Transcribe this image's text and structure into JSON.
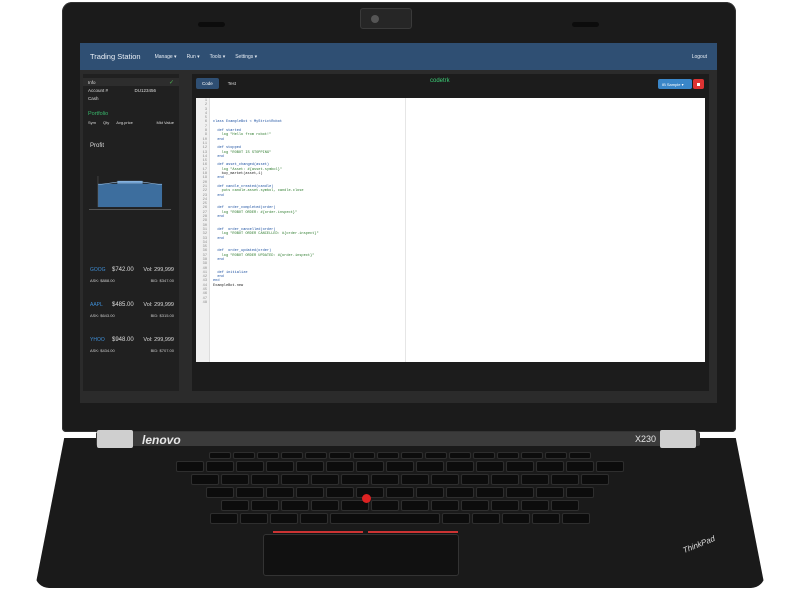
{
  "app": {
    "title": "Trading Station"
  },
  "nav": {
    "items": [
      "Manage ▾",
      "Run ▾",
      "Tools ▾",
      "Settings ▾"
    ],
    "logout": "Logout"
  },
  "sidebar": {
    "rows": [
      {
        "label": "Info",
        "value": ""
      },
      {
        "label": "Account #",
        "value": "DU123456"
      },
      {
        "label": "Cash",
        "value": ""
      }
    ],
    "portfolio_title": "Portfolio",
    "portfolio_cols": [
      "Sym",
      "Qty",
      "Avg.price",
      "Mkt Value"
    ],
    "profit_label": "Profit"
  },
  "tickers": [
    {
      "sym": "GOOG",
      "price": "$742.00",
      "vol": "Vol: 299,999",
      "ask": "ASK: $888.00",
      "bid": "BID: $347.00"
    },
    {
      "sym": "AAPL",
      "price": "$485.00",
      "vol": "Vol: 299,999",
      "ask": "ASK: $643.00",
      "bid": "BID: $315.00"
    },
    {
      "sym": "YHOO",
      "price": "$948.00",
      "vol": "Vol: 299,999",
      "ask": "ASK: $434.00",
      "bid": "BID: $707.00"
    }
  ],
  "editor": {
    "tabs": [
      "Code",
      "Test"
    ],
    "script_name": "codetrk",
    "env_label": "IB Sample",
    "line_count": 48,
    "lines": [
      "",
      "",
      "",
      "",
      "",
      "class ExampleBot < MyStrictRobot",
      "",
      "  def started",
      "    log \"Hello from robot!\"",
      "  end",
      "",
      "  def stopped",
      "    log \"ROBOT IS STOPPING\"",
      "  end",
      "",
      "  def asset_changed(asset)",
      "    log \"Asset: #{asset.symbol}\"",
      "    buy_market(asset,1)",
      "  end",
      "",
      "  def candle_created(candle)",
      "    puts candle.asset.symbol, candle.close",
      "  end",
      "",
      "",
      "  def  order_completed(order)",
      "    log \"ROBOT ORDER: #{order.inspect}\"",
      "  end",
      "",
      "",
      "  def  order_cancelled(order)",
      "    log \"ROBOT ORDER CANCELLED: #{order.inspect}\"",
      "  end",
      "",
      "",
      "  def  order_updated(order)",
      "    log \"ROBOT ORDER UPDATED: #{order.inspect}\"",
      "  end",
      "",
      "",
      "  def initialize",
      "  end",
      "end",
      "ExampleBot.new"
    ]
  },
  "laptop": {
    "brand": "lenovo",
    "model": "X230",
    "badge": "ThinkPad"
  },
  "colors": {
    "navbar": "#2f4f73",
    "accent_green": "#38b86b",
    "ticker_blue": "#3e8ed6",
    "stop_red": "#dd3333"
  }
}
